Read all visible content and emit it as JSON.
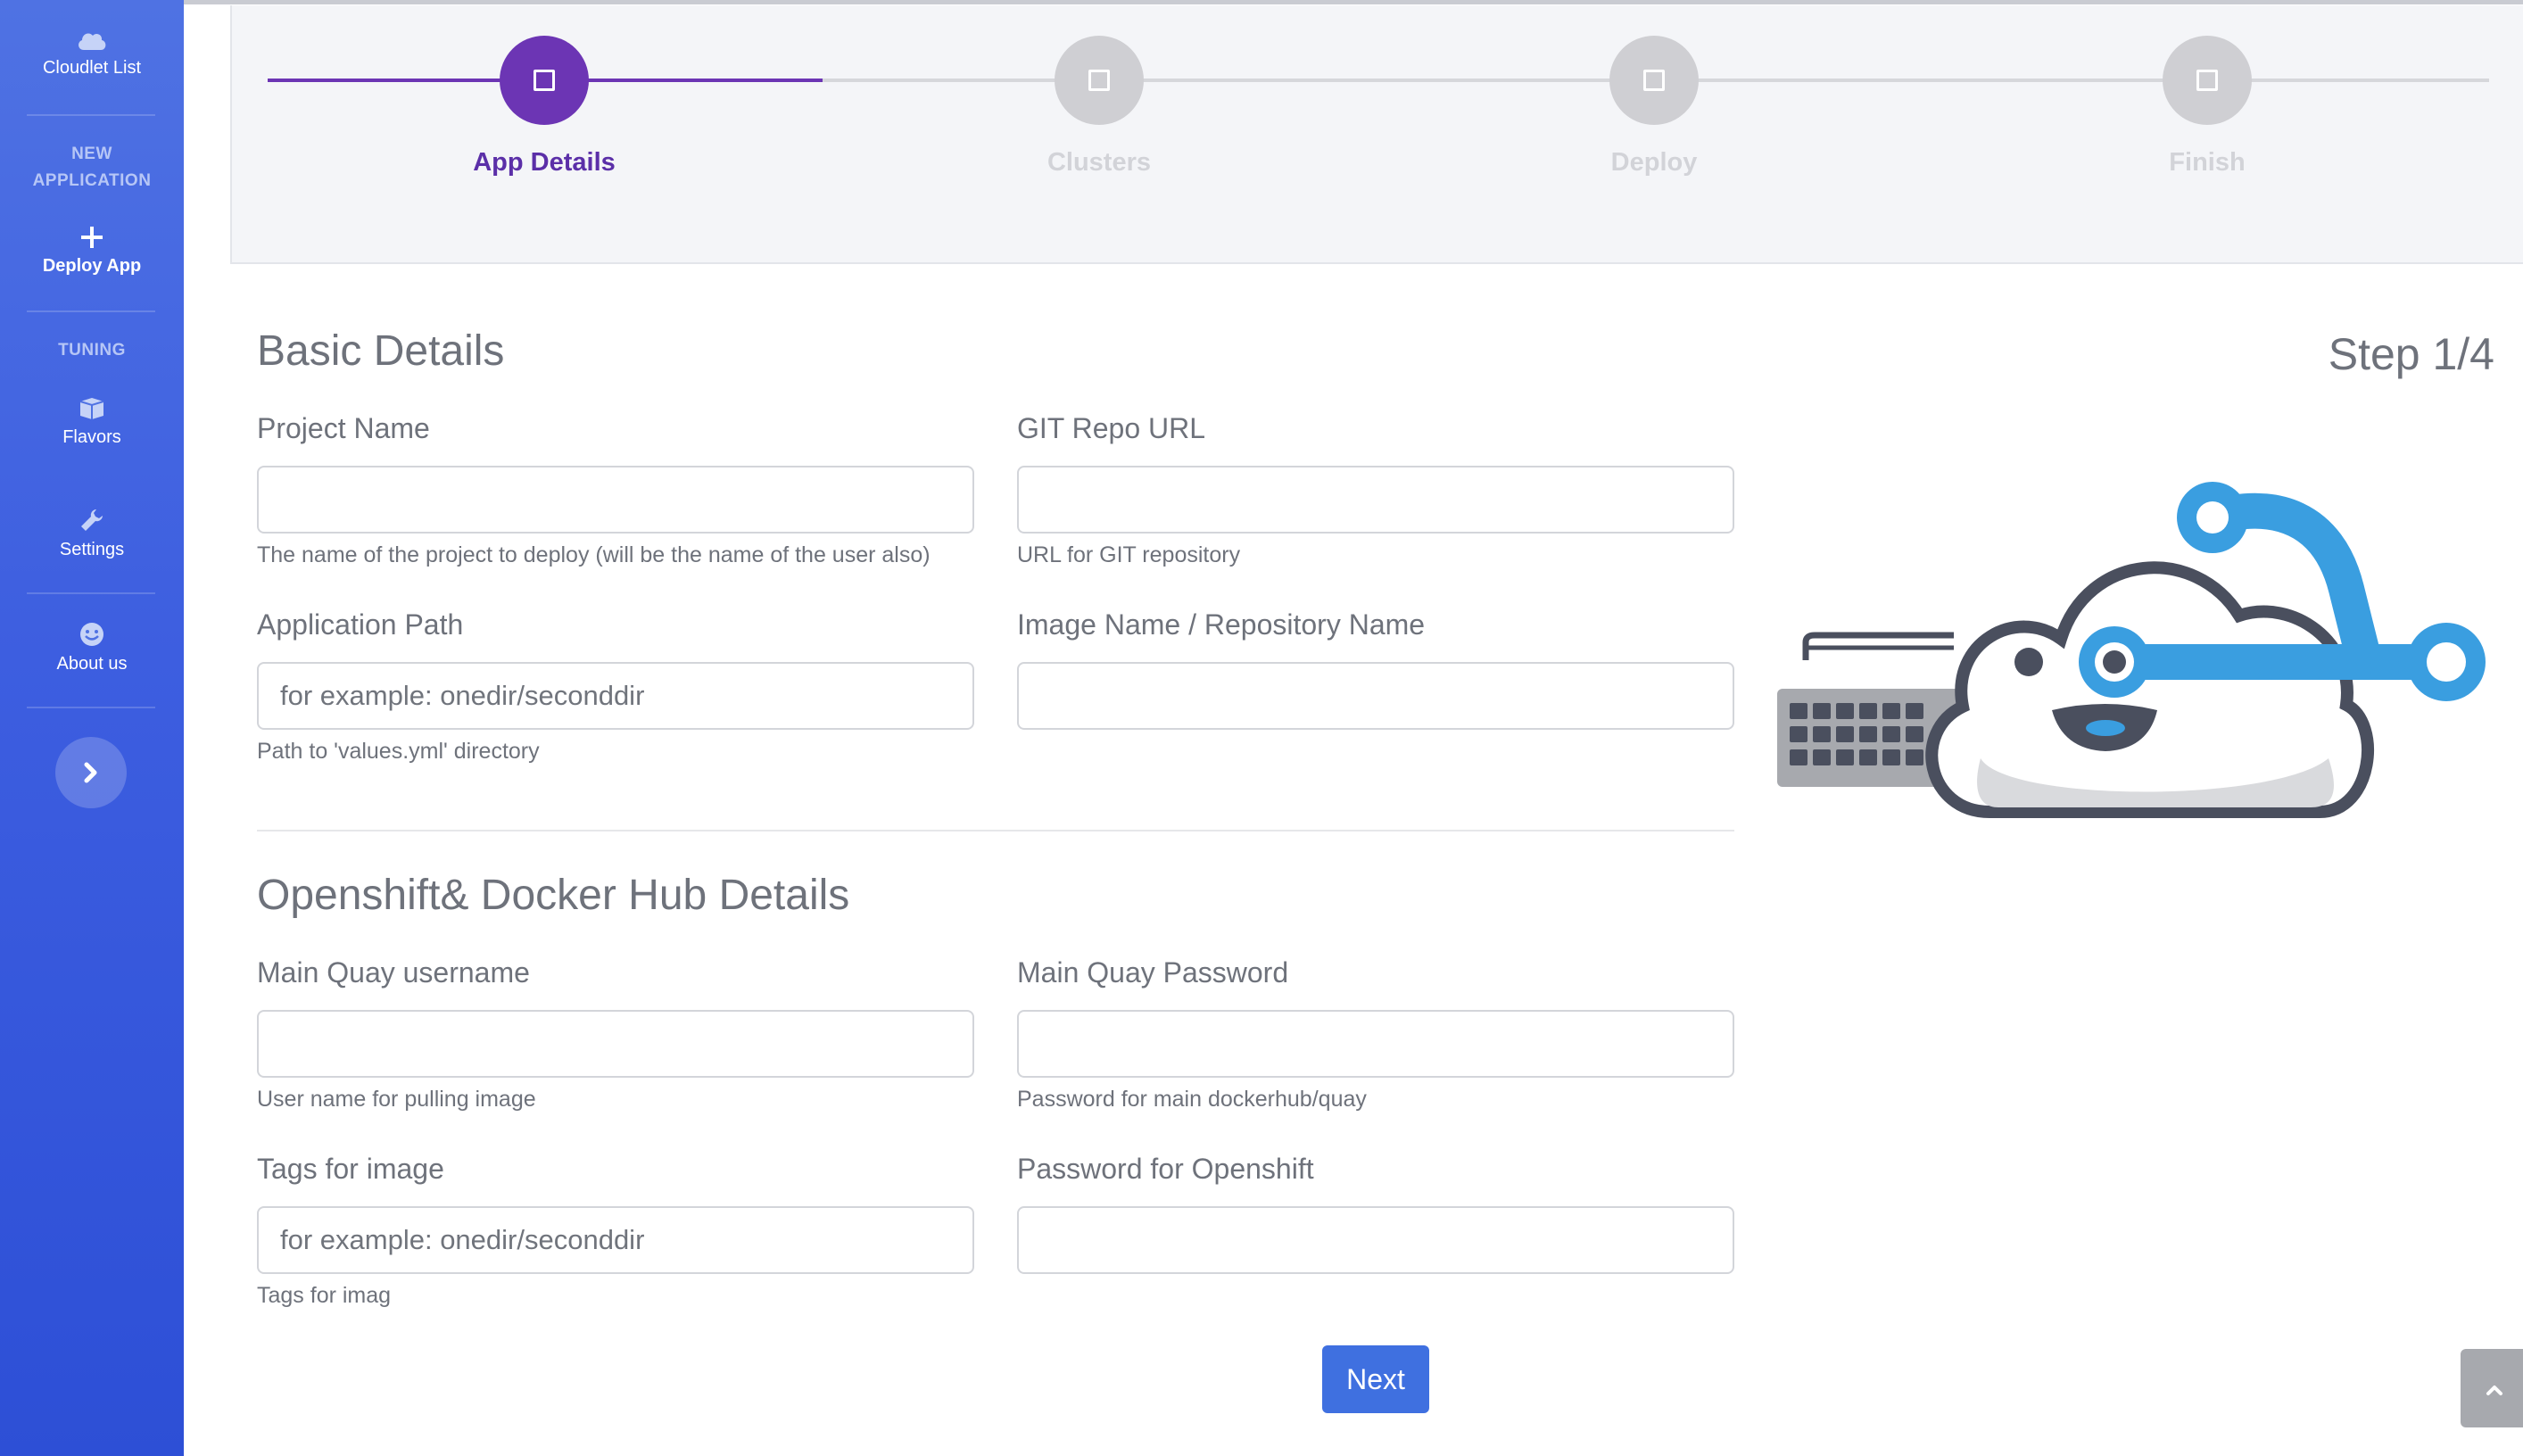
{
  "sidebar": {
    "cloudlet_list": "Cloudlet List",
    "new_application_line1": "NEW",
    "new_application_line2": "APPLICATION",
    "deploy_app": "Deploy App",
    "tuning": "TUNING",
    "flavors": "Flavors",
    "settings": "Settings",
    "about_us": "About us",
    "icons": [
      "cloud-icon",
      "plus-icon",
      "cube-icon",
      "wrench-icon",
      "smiley-icon",
      "chevron-right-icon"
    ]
  },
  "stepper": {
    "steps": [
      {
        "label": "App Details",
        "active": true
      },
      {
        "label": "Clusters",
        "active": false
      },
      {
        "label": "Deploy",
        "active": false
      },
      {
        "label": "Finish",
        "active": false
      }
    ],
    "accent": "#6c35b4",
    "inactive": "#cfcfd3"
  },
  "form": {
    "step_indicator": "Step 1/4",
    "basic": {
      "title": "Basic Details",
      "project_name": {
        "label": "Project Name",
        "value": "",
        "placeholder": "",
        "help": "The name of the project to deploy (will be the name of the user also)"
      },
      "git_repo_url": {
        "label": "GIT Repo URL",
        "value": "",
        "placeholder": "",
        "help": "URL for GIT repository"
      },
      "application_path": {
        "label": "Application Path",
        "value": "",
        "placeholder": "for example: onedir/seconddir",
        "help": "Path to 'values.yml' directory"
      },
      "image_name": {
        "label": "Image Name / Repository Name",
        "value": "",
        "placeholder": ""
      }
    },
    "openshift": {
      "title": "Openshift& Docker Hub Details",
      "quay_username": {
        "label": "Main Quay username",
        "value": "",
        "placeholder": "",
        "help": "User name for pulling image"
      },
      "quay_password": {
        "label": "Main Quay Password",
        "value": "",
        "placeholder": "",
        "help": "Password for main dockerhub/quay"
      },
      "tags": {
        "label": "Tags for image",
        "value": "",
        "placeholder": "for example: onedir/seconddir",
        "help": "Tags for imag"
      },
      "openshift_password": {
        "label": "Password for Openshift",
        "value": "",
        "placeholder": ""
      }
    },
    "next_label": "Next"
  },
  "colors": {
    "sidebar_top": "#4f72e3",
    "sidebar_bottom": "#2d4fd6",
    "next_button": "#3f70e0",
    "illustration_blue": "#3a9ee0",
    "illustration_dark": "#4a4f5e"
  }
}
